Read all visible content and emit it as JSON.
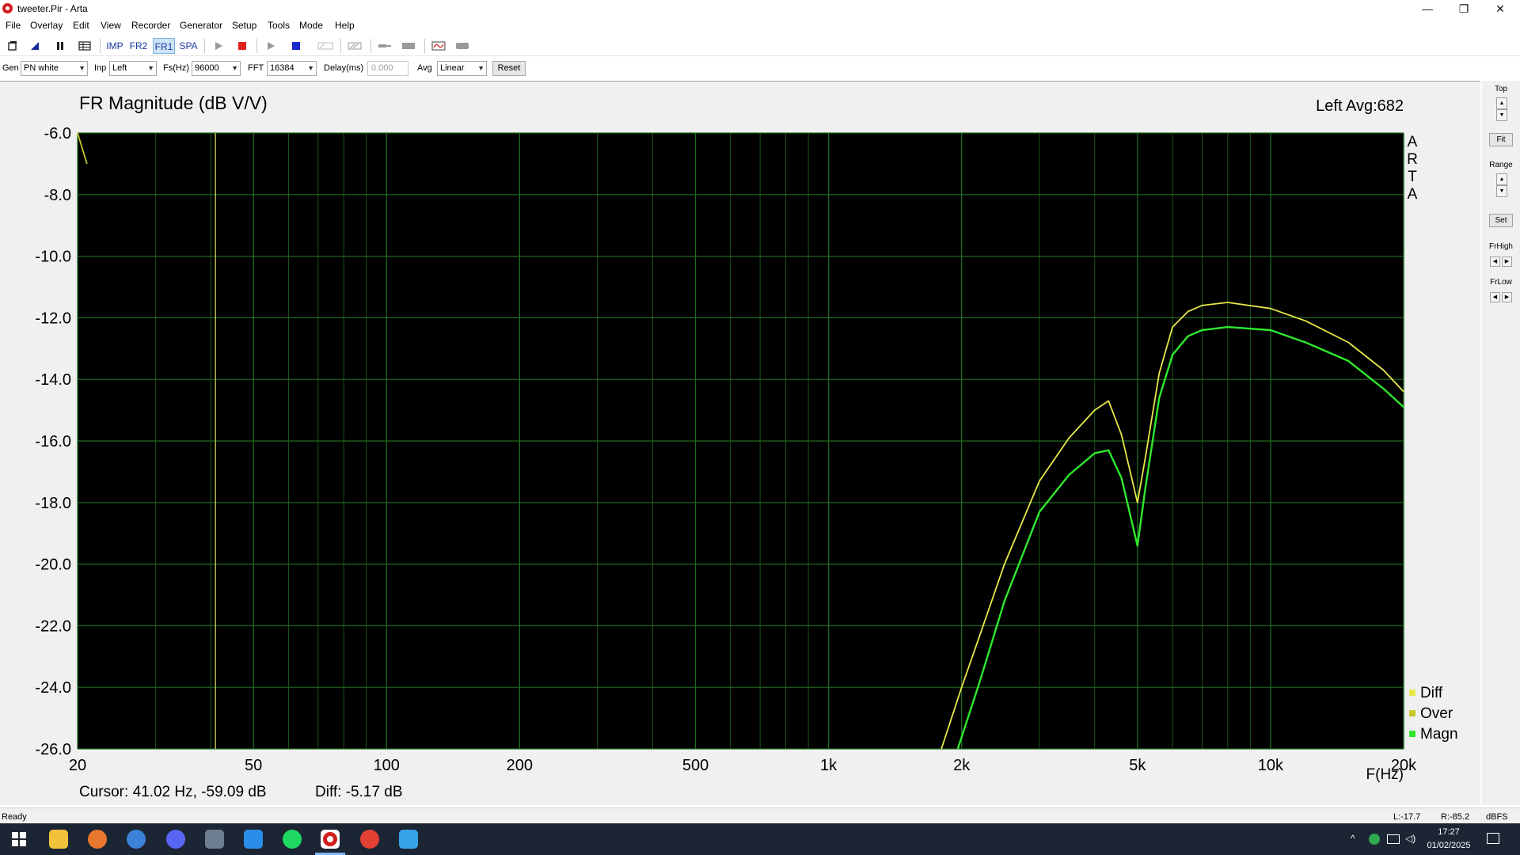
{
  "window": {
    "title": "tweeter.Pir - Arta",
    "minimize": "—",
    "restore": "❐",
    "close": "✕"
  },
  "menu": [
    "File",
    "Overlay",
    "Edit",
    "View",
    "Recorder",
    "Generator",
    "Setup",
    "Tools",
    "Mode",
    "Help"
  ],
  "toolbar": {
    "imp_label": "IMP",
    "fr2_label": "FR2",
    "fr1_label": "FR1",
    "spa_label": "SPA"
  },
  "controls": {
    "gen_label": "Gen",
    "gen_value": "PN white",
    "inp_label": "Inp",
    "inp_value": "Left",
    "fs_label": "Fs(Hz)",
    "fs_value": "96000",
    "fft_label": "FFT",
    "fft_value": "16384",
    "delay_label": "Delay(ms)",
    "delay_value": "0.000",
    "avg_label": "Avg",
    "avg_value": "Linear",
    "reset_label": "Reset"
  },
  "side_panel": {
    "top_label": "Top",
    "fit_label": "Fit",
    "range_label": "Range",
    "set_label": "Set",
    "frhigh_label": "FrHigh",
    "frlow_label": "FrLow"
  },
  "chart_data": {
    "type": "line",
    "title": "FR Magnitude (dB V/V)",
    "channel_info": "Left  Avg:682",
    "watermark": "ARTA",
    "xlabel": "F(Hz)",
    "x_scale": "log",
    "xlim": [
      20,
      20000
    ],
    "ylim": [
      -26,
      -6
    ],
    "x_tick_values": [
      20,
      50,
      100,
      200,
      500,
      1000,
      2000,
      5000,
      10000,
      20000
    ],
    "x_tick_labels": [
      "20",
      "50",
      "100",
      "200",
      "500",
      "1k",
      "2k",
      "5k",
      "10k",
      "20k"
    ],
    "y_ticks": [
      "-6.0",
      "-8.0",
      "-10.0",
      "-12.0",
      "-14.0",
      "-16.0",
      "-18.0",
      "-20.0",
      "-22.0",
      "-24.0",
      "-26.0"
    ],
    "y_tick_values": [
      -6,
      -8,
      -10,
      -12,
      -14,
      -16,
      -18,
      -20,
      -22,
      -24,
      -26
    ],
    "grid": true,
    "background": "#000000",
    "grid_color": "#1f6b1f",
    "cursor_hz": 41.02,
    "cursor_text": "Cursor: 41.02 Hz, -59.09 dB",
    "diff_text": "Diff: -5.17 dB",
    "legend_position": "bottom-right",
    "series": [
      {
        "name": "Diff",
        "color": "#e8e84a",
        "x": [
          20,
          1800,
          2000,
          2200,
          2500,
          3000,
          3500,
          4000,
          4300,
          4600,
          5000,
          5200,
          5600,
          6000,
          6500,
          7000,
          8000,
          10000,
          12000,
          15000,
          18000,
          20000
        ],
        "y": [
          null,
          -26.0,
          -24.0,
          -22.3,
          -20.0,
          -17.3,
          -15.9,
          -15.0,
          -14.7,
          -15.8,
          -18.0,
          -16.6,
          -13.8,
          -12.3,
          -11.8,
          -11.6,
          -11.5,
          -11.7,
          -12.1,
          -12.8,
          -13.7,
          -14.4
        ]
      },
      {
        "name": "Over",
        "color": "#c8c828",
        "x": [
          20,
          21
        ],
        "y": [
          -6.0,
          -7.0
        ]
      },
      {
        "name": "Magn",
        "color": "#2ee82e",
        "x": [
          20,
          1960,
          2200,
          2500,
          3000,
          3500,
          4000,
          4300,
          4600,
          5000,
          5200,
          5600,
          6000,
          6500,
          7000,
          8000,
          10000,
          12000,
          15000,
          18000,
          20000
        ],
        "y": [
          null,
          -26.0,
          -23.8,
          -21.2,
          -18.3,
          -17.1,
          -16.4,
          -16.3,
          -17.2,
          -19.4,
          -17.6,
          -14.6,
          -13.2,
          -12.6,
          -12.4,
          -12.3,
          -12.4,
          -12.8,
          -13.4,
          -14.3,
          -14.9
        ]
      }
    ]
  },
  "status": {
    "ready": "Ready",
    "left_level": "L:-17.7",
    "right_level": "R:-85.2",
    "units": "dBFS"
  },
  "taskbar": {
    "time": "17:27",
    "date": "01/02/2025"
  },
  "icons": {
    "start": "windows-start-icon",
    "explorer": "file-explorer-icon",
    "firefox": "firefox-icon",
    "browser": "browser-icon",
    "discord": "discord-icon",
    "photos": "photos-icon",
    "music": "music-app-icon",
    "spotify": "spotify-icon",
    "arta": "arta-icon",
    "chrome": "chrome-icon",
    "draw": "drawing-app-icon"
  }
}
